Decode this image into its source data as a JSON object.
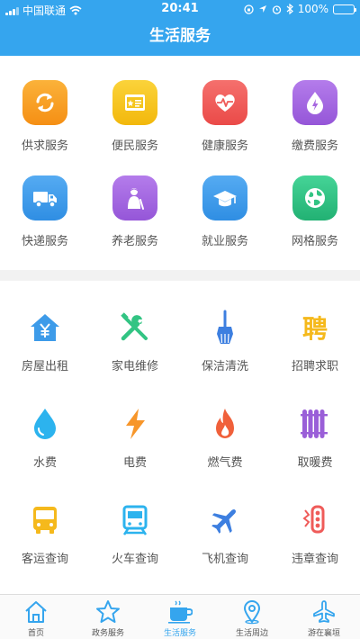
{
  "status_bar": {
    "carrier": "中国联通",
    "time": "20:41",
    "battery": "100%"
  },
  "header": {
    "title": "生活服务"
  },
  "colors": {
    "primary": "#35a5ee",
    "orange": "#f7a21f",
    "yellow": "#f5c51c",
    "red": "#ef5b59",
    "purple": "#a666e0",
    "blue": "#3d9be9",
    "green": "#32c483"
  },
  "services": [
    {
      "label": "供求服务",
      "icon": "refresh-icon"
    },
    {
      "label": "便民服务",
      "icon": "id-card-icon"
    },
    {
      "label": "健康服务",
      "icon": "heart-pulse-icon"
    },
    {
      "label": "缴费服务",
      "icon": "water-drop-bolt-icon"
    },
    {
      "label": "快递服务",
      "icon": "truck-icon"
    },
    {
      "label": "养老服务",
      "icon": "elder-icon"
    },
    {
      "label": "就业服务",
      "icon": "graduation-cap-icon"
    },
    {
      "label": "网格服务",
      "icon": "globe-icon"
    }
  ],
  "utilities": [
    {
      "label": "房屋出租",
      "icon": "house-yuan-icon"
    },
    {
      "label": "家电维修",
      "icon": "tools-icon"
    },
    {
      "label": "保洁清洗",
      "icon": "broom-icon"
    },
    {
      "label": "招聘求职",
      "icon": "pin-character-icon",
      "glyph": "聘"
    },
    {
      "label": "水费",
      "icon": "water-drop-icon"
    },
    {
      "label": "电费",
      "icon": "lightning-icon"
    },
    {
      "label": "燃气费",
      "icon": "flame-icon"
    },
    {
      "label": "取暖费",
      "icon": "radiator-icon"
    },
    {
      "label": "客运查询",
      "icon": "bus-icon"
    },
    {
      "label": "火车查询",
      "icon": "train-icon"
    },
    {
      "label": "飞机查询",
      "icon": "airplane-icon"
    },
    {
      "label": "违章查询",
      "icon": "violation-icon"
    }
  ],
  "tabbar": [
    {
      "label": "首页",
      "icon": "home-icon"
    },
    {
      "label": "政务服务",
      "icon": "star-icon"
    },
    {
      "label": "生活服务",
      "icon": "coffee-cup-icon",
      "active": true
    },
    {
      "label": "生活周边",
      "icon": "location-pin-icon"
    },
    {
      "label": "游在襄垣",
      "icon": "airplane-icon"
    }
  ]
}
